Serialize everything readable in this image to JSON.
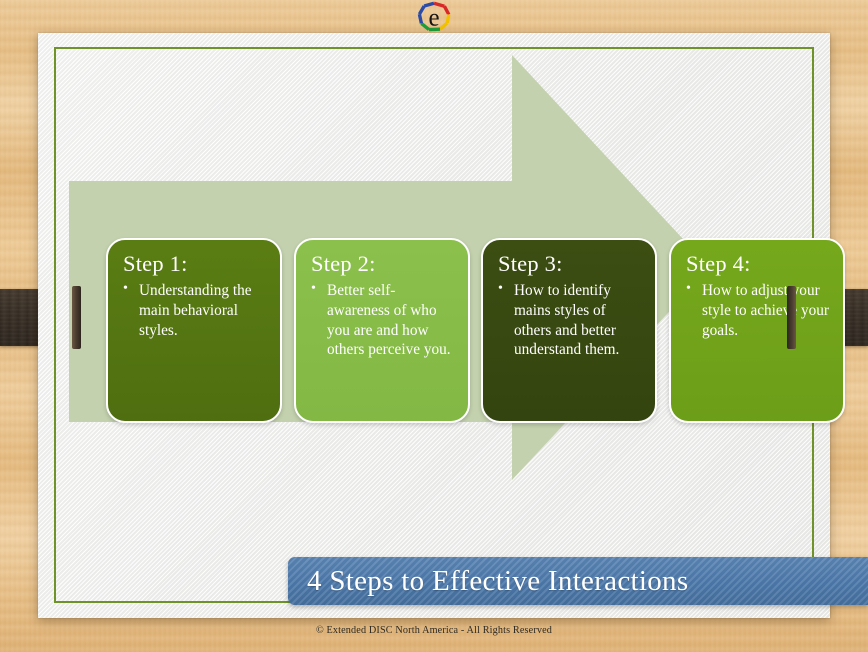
{
  "slide": {
    "title": "4 Steps to Effective Interactions",
    "footer": "© Extended DISC North America  - All Rights Reserved",
    "logo_letter": "e",
    "logo_name": "extended-disc-logo",
    "colors": {
      "background_wood": "#e7bf86",
      "slide_paper": "#f1f1ef",
      "inner_border_green": "#6f9328",
      "arrow_sage": "#c3d1ae",
      "banner_blue": "#4f7cad",
      "strap_brown": "#3a3027",
      "step1": "#546f12",
      "step2": "#88bc49",
      "step3": "#3a4c12",
      "step4": "#72a31b"
    }
  },
  "arrow": {
    "label": "process-arrow",
    "direction": "right",
    "fill": "#c3d1ae"
  },
  "steps": [
    {
      "id": "step-1",
      "title": "Step 1:",
      "bullets": [
        "Understanding the main behavioral styles."
      ],
      "color": "#546f12"
    },
    {
      "id": "step-2",
      "title": "Step 2:",
      "bullets": [
        "Better self-awareness of who you are and how others perceive you."
      ],
      "color": "#88bc49"
    },
    {
      "id": "step-3",
      "title": "Step 3:",
      "bullets": [
        "How to identify mains styles of others and better understand them."
      ],
      "color": "#3a4c12"
    },
    {
      "id": "step-4",
      "title": "Step 4:",
      "bullets": [
        "How to adjust your style to achieve your goals."
      ],
      "color": "#72a31b"
    }
  ]
}
